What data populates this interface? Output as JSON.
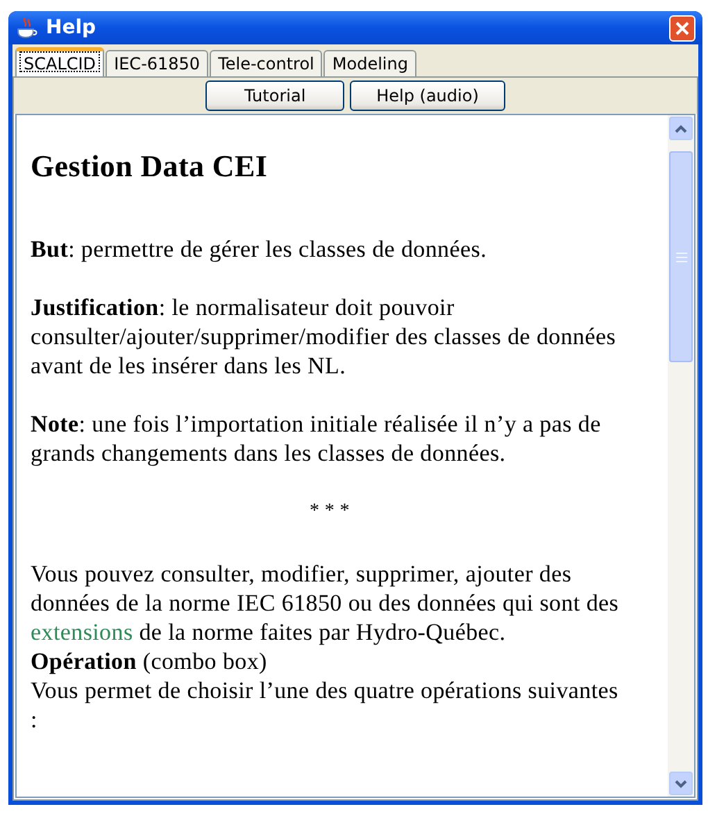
{
  "window": {
    "title": "Help"
  },
  "tabs": [
    {
      "label": "SCALCID",
      "selected": true
    },
    {
      "label": "IEC-61850",
      "selected": false
    },
    {
      "label": "Tele-control",
      "selected": false
    },
    {
      "label": "Modeling",
      "selected": false
    }
  ],
  "buttons": [
    "Tutorial",
    "Help (audio)"
  ],
  "content": [
    {
      "kind": "heading",
      "text": "Gestion Data CEI"
    },
    {
      "kind": "para",
      "text": "**But**: permettre de gérer les classes de données."
    },
    {
      "kind": "para",
      "text": "**Justification**: le normalisateur doit pouvoir consulter/ajouter/supprimer/modifier des classes de données avant de les insérer dans les NL."
    },
    {
      "kind": "para",
      "text": "**Note**: une fois l’importation initiale réalisée il n’y a pas de grands changements dans les classes de données."
    },
    {
      "kind": "separator",
      "text": "* * *"
    },
    {
      "kind": "linked",
      "parts": [
        {
          "kind": "text",
          "text": "Vous pouvez consulter, modifier, supprimer, ajouter des données de la norme IEC 61850 ou des données qui sont des "
        },
        {
          "kind": "link",
          "text": "extensions"
        },
        {
          "kind": "text",
          "text": " de la norme faites par Hydro-Québec."
        }
      ]
    },
    {
      "kind": "line",
      "text": "**Opération** (combo box)"
    },
    {
      "kind": "line",
      "text": "Vous permet de choisir l’une des quatre opérations suivantes :"
    }
  ]
}
